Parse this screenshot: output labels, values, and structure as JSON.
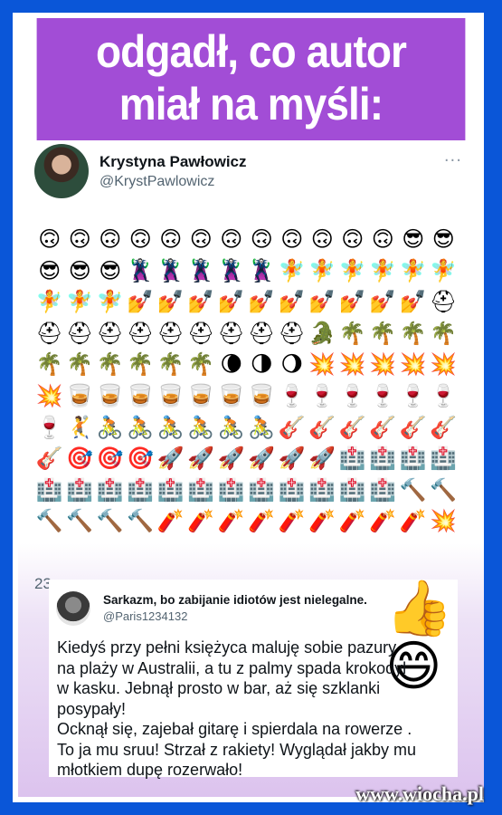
{
  "headline": {
    "line1": "odgadł, co autor",
    "line2": "miał na myśli:"
  },
  "tweet": {
    "author_name": "Krystyna Pawłowicz",
    "author_handle": "@KrystPawlowicz",
    "more_icon": "···",
    "emoji_rows": [
      "🙃🙃🙃🙃🙃🙃🙃🙃🙃🙃🙃🙃😎😎",
      "😎😎😎🦹🦹🦹🦹🦹🧚🧚🧚🧚🧚🧚",
      "🧚🧚🧚💅💅💅💅💅💅💅💅💅💅⛑️",
      "⛑️⛑️⛑️⛑️⛑️⛑️⛑️⛑️⛑️🐊🌴🌴🌴🌴",
      "🌴🌴🌴🌴🌴🌴🌘🌗🌖💥💥💥💥💥",
      "💥🥃🥃🥃🥃🥃🥃🥃🍷🍷🍷🍷🍷🍷",
      "🍷🤾🚴🚴🚴🚴🚴🚴🎸🎸🎸🎸🎸🎸",
      "🎸🎯🎯🎯🚀🚀🚀🚀🚀🚀🏥🏥🏥🏥",
      "🏥🏥🏥🏥🏥🏥🏥🏥🏥🏥🏥🏥🔨🔨",
      "🔨🔨🔨🔨🧨🧨🧨🧨🧨🧨🧨🧨🧨💥"
    ]
  },
  "side_count": "23",
  "reply": {
    "author_name": "Sarkazm, bo zabijanie idiotów jest nielegalne.",
    "author_handle": "@Paris1234132",
    "emoji": "👍😄",
    "text": "Kiedyś przy pełni księżyca maluję sobie pazury\nna plaży w Australii, a tu z palmy spada krokodyl\nw kasku. Jebnął prosto w bar, aż się szklanki\nposypały!\nOcknął się, zajebał gitarę i spierdala na rowerze .\nTo ja mu sruu! Strzał z rakiety! Wyglądał jakby mu\nmłotkiem dupę rozerwało!"
  },
  "watermark": "www.wiocha.pl",
  "colors": {
    "border": "#0a56d8",
    "headline_bg": "#a24dd6",
    "text": "#0f1419",
    "muted": "#536471"
  }
}
